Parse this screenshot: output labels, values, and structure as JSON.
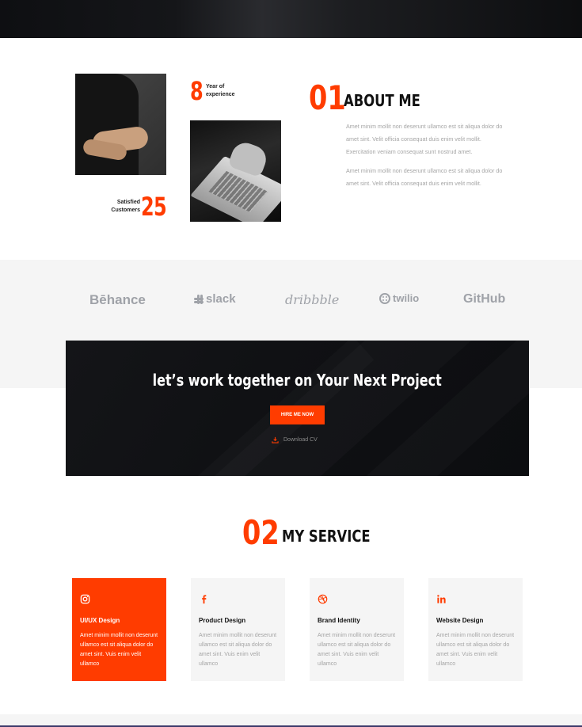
{
  "about": {
    "stat_years": {
      "number": "8",
      "label_line1": "Year of",
      "label_line2": "experience"
    },
    "stat_customers": {
      "number": "25",
      "label_line1": "Satisfied",
      "label_line2": "Customers"
    },
    "section_number": "01",
    "title": "ABOUT ME",
    "paragraph1": "Amet minim mollit non deserunt ullamco est sit aliqua dolor do amet sint. Velit officia consequat duis enim velit mollit. Exercitation veniam consequat sunt nostrud amet.",
    "paragraph2": "Amet minim mollit non deserunt ullamco est sit aliqua dolor do amet sint. Velit officia consequat duis enim velit mollit."
  },
  "brands": [
    {
      "name": "Bēhance",
      "icon": "behance-logo"
    },
    {
      "name": "slack",
      "icon": "slack-logo"
    },
    {
      "name": "dribbble",
      "icon": "dribbble-logo"
    },
    {
      "name": "twilio",
      "icon": "twilio-logo"
    },
    {
      "name": "GitHub",
      "icon": "github-logo"
    }
  ],
  "cta": {
    "title": "let’s work together on Your Next Project",
    "hire_label": "HIRE ME NOW",
    "download_label": "Download CV"
  },
  "service": {
    "section_number": "02",
    "title": "MY SERVICE",
    "cards": [
      {
        "icon": "instagram-icon",
        "title": "UI/UX Design",
        "text": "Amet minim mollit non deserunt ullamco est sit aliqua dolor do amet sint. Vuis enim velit ullamco",
        "active": true
      },
      {
        "icon": "facebook-icon",
        "title": "Product Design",
        "text": "Amet minim mollit non deserunt ullamco est sit aliqua dolor do amet sint. Vuis enim velit ullamco",
        "active": false
      },
      {
        "icon": "dribbble-icon",
        "title": "Brand Identity",
        "text": "Amet minim mollit non deserunt ullamco est sit aliqua dolor do amet sint. Vuis enim velit ullamco",
        "active": false
      },
      {
        "icon": "linkedin-icon",
        "title": "Website Design",
        "text": "Amet minim mollit non deserunt ullamco est sit aliqua dolor do amet sint. Vuis enim velit ullamco",
        "active": false
      }
    ]
  },
  "colors": {
    "accent": "#ff3c00",
    "dark": "#111214",
    "muted": "#a5a5a5",
    "band": "#f5f5f5"
  }
}
